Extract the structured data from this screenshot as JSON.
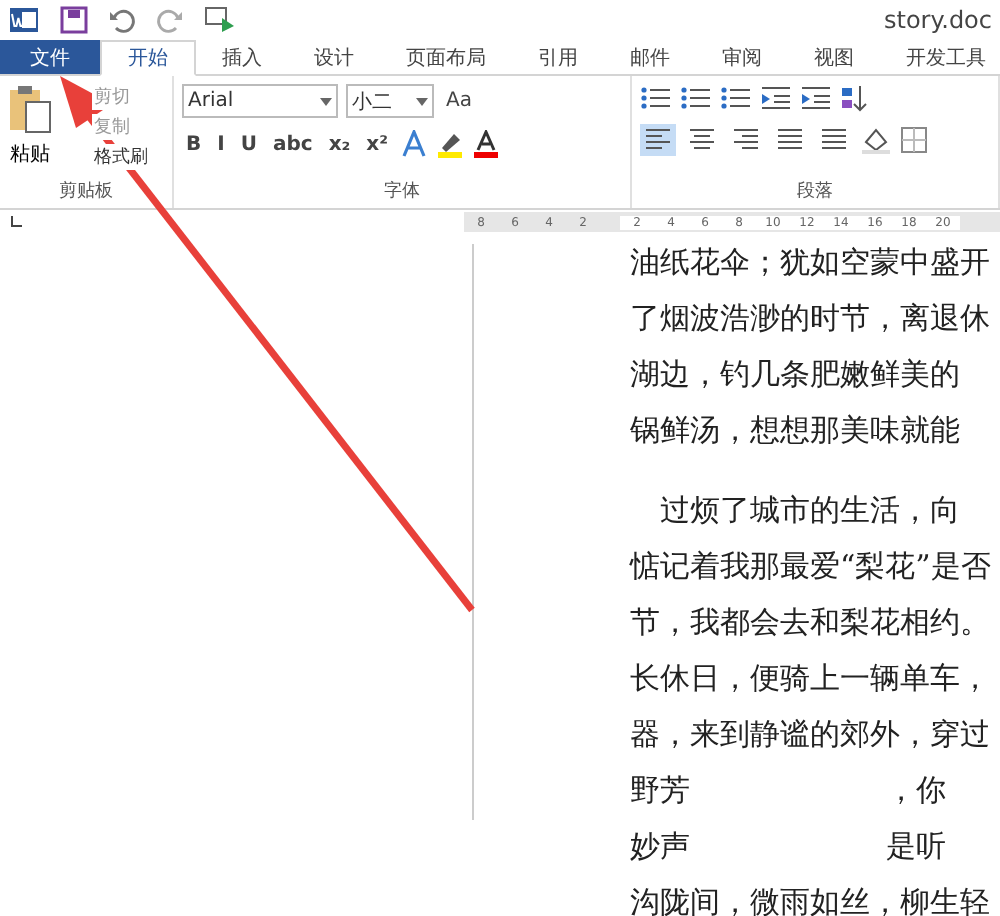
{
  "window": {
    "title": "story.doc"
  },
  "tabs": [
    {
      "label": "文件",
      "kind": "file",
      "selected": false
    },
    {
      "label": "开始",
      "kind": "tab",
      "selected": true
    },
    {
      "label": "插入",
      "kind": "tab",
      "selected": false
    },
    {
      "label": "设计",
      "kind": "tab",
      "selected": false
    },
    {
      "label": "页面布局",
      "kind": "tab",
      "selected": false
    },
    {
      "label": "引用",
      "kind": "tab",
      "selected": false
    },
    {
      "label": "邮件",
      "kind": "tab",
      "selected": false
    },
    {
      "label": "审阅",
      "kind": "tab",
      "selected": false
    },
    {
      "label": "视图",
      "kind": "tab",
      "selected": false
    },
    {
      "label": "开发工具",
      "kind": "tab",
      "selected": false
    }
  ],
  "clipboard": {
    "label": "剪贴板",
    "paste": "粘贴",
    "items": [
      {
        "label": "剪切",
        "disabled": true
      },
      {
        "label": "复制",
        "disabled": true
      },
      {
        "label": "格式刷",
        "disabled": false
      }
    ]
  },
  "font": {
    "label": "字体",
    "family": "Arial",
    "size": "小二",
    "case_button": "Aa",
    "buttons": [
      "B",
      "I",
      "U",
      "abc",
      "x₂",
      "x²"
    ]
  },
  "paragraph": {
    "label": "段落",
    "alignments": [
      {
        "selected": true
      },
      {
        "selected": false
      },
      {
        "selected": false
      },
      {
        "selected": false
      },
      {
        "selected": false
      }
    ]
  },
  "ruler": {
    "left_ticks": [
      "8",
      "6",
      "4",
      "2"
    ],
    "right_ticks": [
      "2",
      "4",
      "6",
      "8",
      "10",
      "12",
      "14",
      "16",
      "18",
      "20"
    ]
  },
  "document": {
    "paragraphs": [
      {
        "indent": false,
        "lines": [
          [
            "油纸花伞；犹如空蒙中盛开"
          ],
          [
            "了烟波浩渺的时节，离退休"
          ],
          [
            "湖边，钓几条肥嫩鲜美的"
          ],
          [
            "锅鲜汤，想想那美味就能"
          ]
        ]
      },
      {
        "indent": true,
        "lines": [
          [
            "过烦了城市的生活，向"
          ],
          [
            "惦记着我那最爱“梨花”是否"
          ],
          [
            "节，我都会去和梨花相约。"
          ],
          [
            "长休日，便骑上一辆单车，"
          ],
          [
            "器，来到静谧的郊外，穿过"
          ],
          [
            "野芳",
            "，你"
          ],
          [
            "妙声",
            "是听"
          ],
          [
            "沟陇间，微雨如丝，柳生轻"
          ]
        ]
      }
    ]
  }
}
